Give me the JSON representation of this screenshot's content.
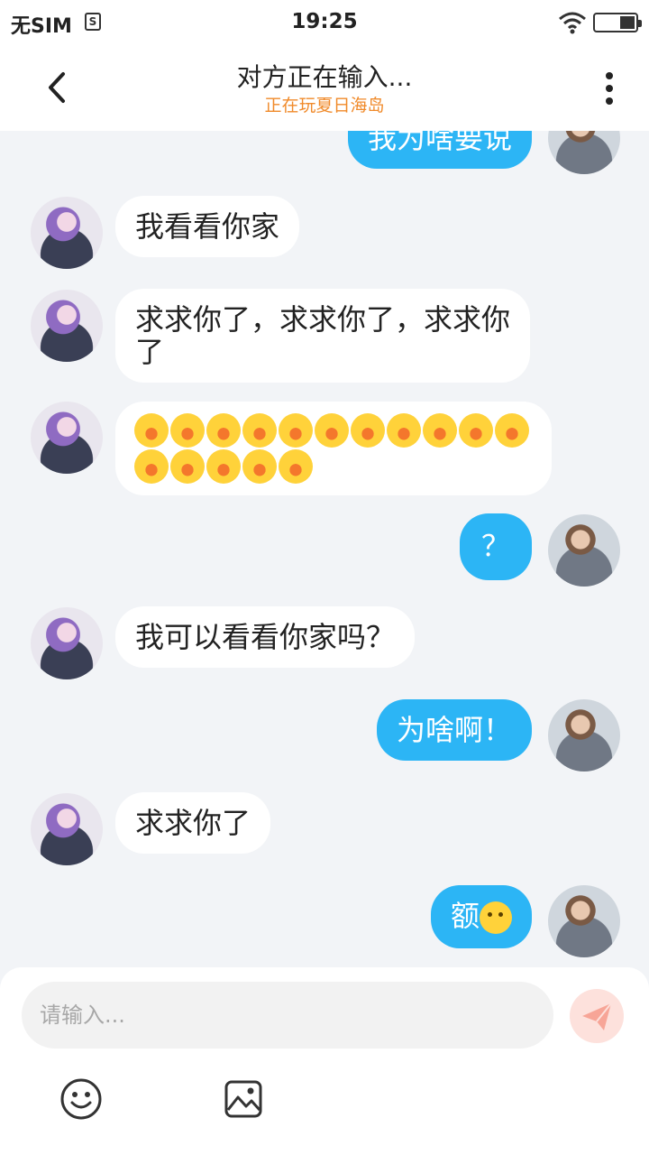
{
  "status_bar": {
    "carrier": "无SIM",
    "sim_icon_letter": "S",
    "time": "19:25",
    "icons": [
      "sim-card-icon",
      "wifi-icon",
      "battery-icon"
    ]
  },
  "header": {
    "title": "对方正在输入...",
    "subtitle": "正在玩夏日海岛",
    "back_icon": "back-chevron-icon",
    "more_icon": "more-vertical-icon"
  },
  "colors": {
    "accent": "#2cb5f5",
    "subtitle": "#f08a2a",
    "background": "#f2f4f7"
  },
  "messages": [
    {
      "side": "right",
      "text": "我为啥要说"
    },
    {
      "side": "left",
      "text": "我看看你家"
    },
    {
      "side": "left",
      "text": "求求你了，求求你了，求求你了"
    },
    {
      "side": "left",
      "type": "emoji",
      "emoji_name": "crying-laughing-emoji",
      "count": 16
    },
    {
      "side": "right",
      "text": "？"
    },
    {
      "side": "left",
      "text": "我可以看看你家吗？"
    },
    {
      "side": "right",
      "text": "为啥啊！"
    },
    {
      "side": "left",
      "text": "求求你了"
    },
    {
      "side": "right",
      "text": "额",
      "emoji_name": "sweat-smile-emoji"
    }
  ],
  "input": {
    "placeholder": "请输入...",
    "value": "",
    "send_icon": "paper-plane-icon",
    "emoji_icon": "smiley-icon",
    "image_icon": "image-icon"
  }
}
